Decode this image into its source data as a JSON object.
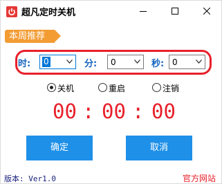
{
  "window": {
    "title": "超凡定时关机",
    "minimize_glyph": "—",
    "maximize_glyph": "☐",
    "close_glyph": "✕"
  },
  "recommend": {
    "label": "本周推荐"
  },
  "time": {
    "hour_label": "时:",
    "minute_label": "分:",
    "second_label": "秒:",
    "hour_value": "0",
    "minute_value": "0",
    "second_value": "0"
  },
  "actions": {
    "options": [
      "关机",
      "重启",
      "注销"
    ],
    "selected": "关机"
  },
  "countdown": {
    "hours": "00",
    "minutes": "00",
    "seconds": "00",
    "separator": ":"
  },
  "buttons": {
    "confirm": "确定",
    "cancel": "取消"
  },
  "footer": {
    "version": "版本: Ver1.0",
    "website": "官方网站"
  },
  "colors": {
    "accent_blue": "#1e90e8",
    "alert_red": "#e8202a",
    "tag_orange": "#f39c34"
  }
}
